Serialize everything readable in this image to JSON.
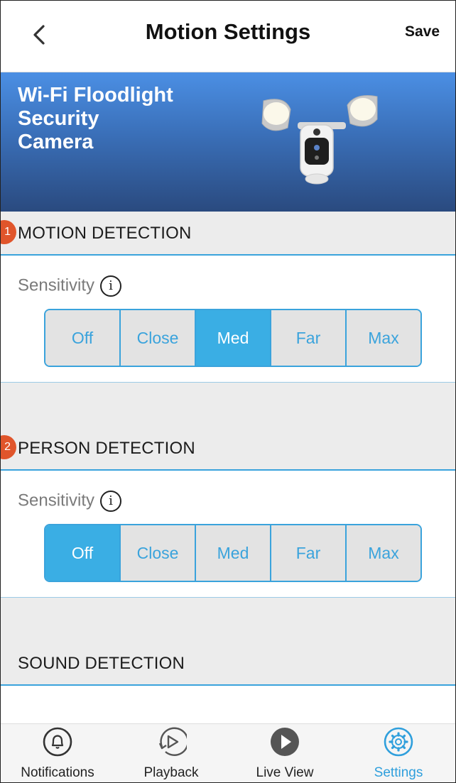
{
  "header": {
    "title": "Motion Settings",
    "save_label": "Save"
  },
  "banner": {
    "product_name": "Wi-Fi Floodlight Security Camera"
  },
  "sections": [
    {
      "badge": "1",
      "title": "MOTION DETECTION",
      "sensitivity_label": "Sensitivity",
      "options": [
        "Off",
        "Close",
        "Med",
        "Far",
        "Max"
      ],
      "selected": "Med"
    },
    {
      "badge": "2",
      "title": "PERSON DETECTION",
      "sensitivity_label": "Sensitivity",
      "options": [
        "Off",
        "Close",
        "Med",
        "Far",
        "Max"
      ],
      "selected": "Off"
    },
    {
      "title": "SOUND DETECTION"
    }
  ],
  "nav": {
    "items": [
      "Notifications",
      "Playback",
      "Live View",
      "Settings"
    ],
    "active": "Settings"
  },
  "colors": {
    "accent": "#3aaee4",
    "badge": "#e0552b",
    "banner_top": "#4b8fe4",
    "banner_bottom": "#2a4a7f"
  }
}
